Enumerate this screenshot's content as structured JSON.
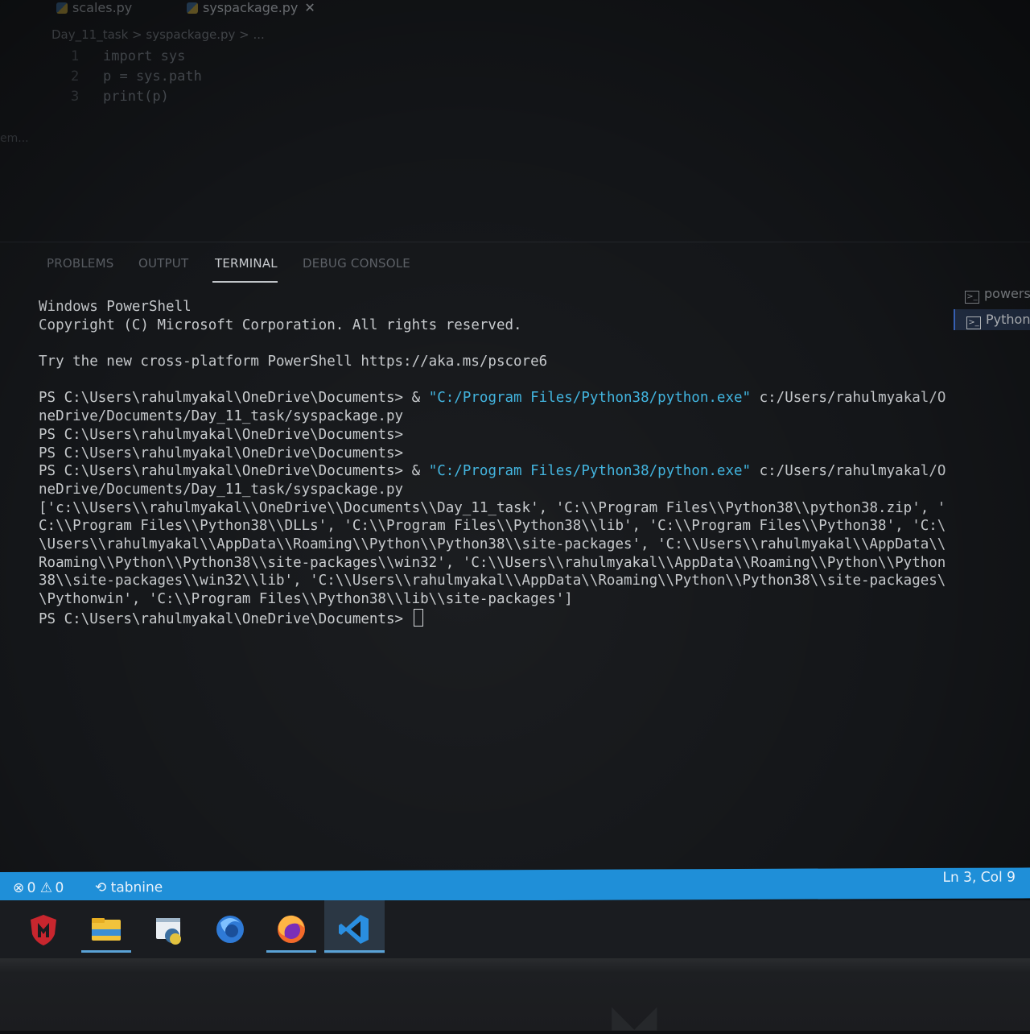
{
  "editor": {
    "tabs": [
      {
        "label": "scales.py",
        "active": false
      },
      {
        "label": "syspackage.py",
        "active": true
      }
    ],
    "close_symbol": "✕",
    "breadcrumb": "Day_11_task > syspackage.py > ...",
    "code": [
      {
        "ln": "1",
        "text": "import sys"
      },
      {
        "ln": "2",
        "text": "p = sys.path"
      },
      {
        "ln": "3",
        "text": "print(p)"
      }
    ],
    "edge_text": "em..."
  },
  "panel": {
    "tabs": [
      {
        "label": "PROBLEMS",
        "active": false
      },
      {
        "label": "OUTPUT",
        "active": false
      },
      {
        "label": "TERMINAL",
        "active": true
      },
      {
        "label": "DEBUG CONSOLE",
        "active": false
      }
    ],
    "terminal_list": [
      {
        "label": "powershell",
        "active": false
      },
      {
        "label": "Python",
        "active": true
      }
    ]
  },
  "terminal": {
    "header1": "Windows PowerShell",
    "header2": "Copyright (C) Microsoft Corporation. All rights reserved.",
    "header3": "Try the new cross-platform PowerShell https://aka.ms/pscore6",
    "prompt": "PS C:\\Users\\rahulmyakal\\OneDrive\\Documents>",
    "amp": "&",
    "exe": "\"C:/Program Files/Python38/python.exe\"",
    "script_part1": "c:/Users/rahulmyakal/O",
    "script_part2": "neDrive/Documents/Day_11_task/syspackage.py",
    "output": [
      "['c:\\\\Users\\\\rahulmyakal\\\\OneDrive\\\\Documents\\\\Day_11_task', 'C:\\\\Program Files\\\\Python38\\\\python38.zip', '",
      "C:\\\\Program Files\\\\Python38\\\\DLLs', 'C:\\\\Program Files\\\\Python38\\\\lib', 'C:\\\\Program Files\\\\Python38', 'C:\\",
      "\\Users\\\\rahulmyakal\\\\AppData\\\\Roaming\\\\Python\\\\Python38\\\\site-packages', 'C:\\\\Users\\\\rahulmyakal\\\\AppData\\\\",
      "Roaming\\\\Python\\\\Python38\\\\site-packages\\\\win32', 'C:\\\\Users\\\\rahulmyakal\\\\AppData\\\\Roaming\\\\Python\\\\Python",
      "38\\\\site-packages\\\\win32\\\\lib', 'C:\\\\Users\\\\rahulmyakal\\\\AppData\\\\Roaming\\\\Python\\\\Python38\\\\site-packages\\",
      "\\Pythonwin', 'C:\\\\Program Files\\\\Python38\\\\lib\\\\site-packages']"
    ]
  },
  "statusbar": {
    "errors_icon": "⊗",
    "errors": "0",
    "warnings_icon": "⚠",
    "warnings": "0",
    "tabnine": "tabnine",
    "cursor_pos": "Ln 3, Col 9",
    "color": "#1f8fd8"
  },
  "taskbar": {
    "apps": [
      {
        "icon": "mcafee-shield-icon",
        "color": "#c8262e"
      },
      {
        "icon": "file-explorer-icon",
        "color": "#f2c33b"
      },
      {
        "icon": "python-idle-icon",
        "color": "#3b6fa0"
      },
      {
        "icon": "firefox-blue-icon",
        "color": "#2f7ad6"
      },
      {
        "icon": "firefox-icon",
        "color": "#f36a2a"
      },
      {
        "icon": "vscode-icon",
        "color": "#2a8ee0"
      }
    ]
  }
}
